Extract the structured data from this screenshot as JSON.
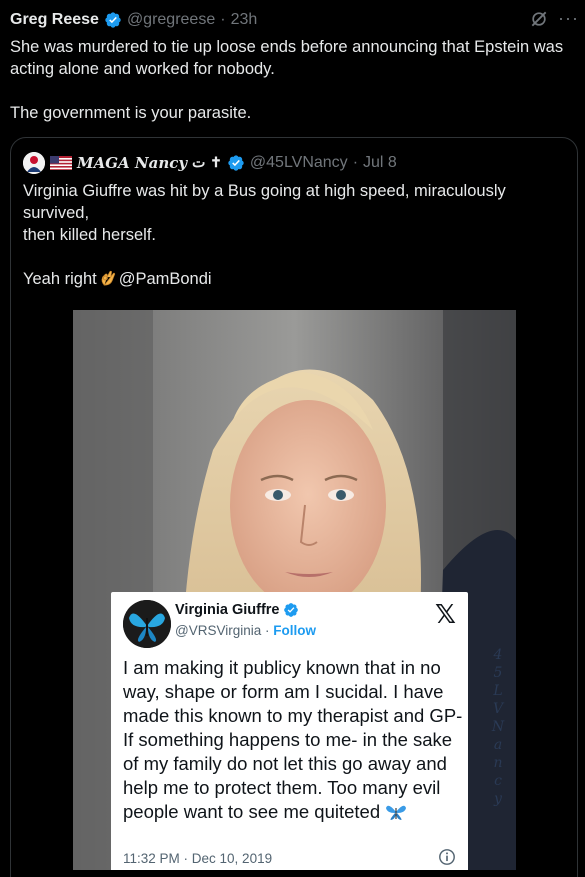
{
  "tweet": {
    "author_name": "Greg Reese",
    "author_handle": "@gregreese",
    "separator": "·",
    "time": "23h",
    "text_line1": "She was murdered to tie up loose ends before announcing that Epstein was acting alone and worked for nobody.",
    "text_line2": "The government is your parasite.",
    "more_label": "···"
  },
  "quote": {
    "author_name": "MAGA Nancy",
    "author_suffix": "ت ✝",
    "author_handle": "@45LVNancy",
    "separator": "·",
    "date": "Jul 8",
    "text_line1": "Virginia Giuffre was hit by a Bus going at high speed, miraculously survived,",
    "text_line2": "then killed herself.",
    "text_line3_a": "Yeah right",
    "text_line3_b": "@PamBondi"
  },
  "embedded_card": {
    "name": "Virginia Giuffre",
    "handle": "@VRSVirginia",
    "separator": "·",
    "follow_label": "Follow",
    "x_logo": "𝕏",
    "text": "I am making it publicy known that in no way, shape or form am I sucidal. I have made this known to my therapist and GP- If something happens to me- in the sake of my family do not let this go away and help me to protect them. Too many evil people want to see me quiteted",
    "timestamp": "11:32 PM · Dec 10, 2019"
  },
  "watermark_letters": [
    "4",
    "5",
    "L",
    "V",
    "N",
    "a",
    "n",
    "c",
    "y"
  ],
  "colors": {
    "background": "#000000",
    "text_primary": "#e7e9ea",
    "text_secondary": "#71767b",
    "verified_blue": "#1d9bf0",
    "border": "#2f3336"
  },
  "icons": {
    "verified": "verified-badge-icon",
    "grok": "grok-icon",
    "more": "more-icon",
    "ok_hand": "ok-hand-emoji-icon",
    "butterfly": "butterfly-emoji-icon",
    "info": "info-icon",
    "flag": "us-flag-icon"
  }
}
